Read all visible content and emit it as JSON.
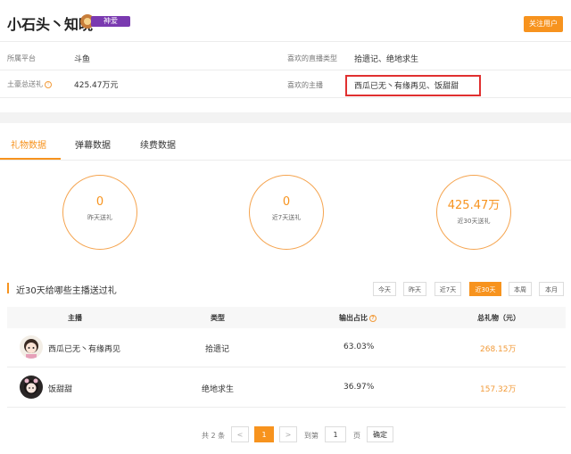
{
  "header": {
    "name": "小石头丶知晓",
    "noble_badge": "神爱",
    "follow_button": "关注用户"
  },
  "info": {
    "platform_label": "所属平台",
    "platform_value": "斗鱼",
    "fav_type_label": "喜欢的直播类型",
    "fav_type_value": "拾遗记、绝地求生",
    "total_gift_label": "土豪总送礼",
    "total_gift_value": "425.47万元",
    "fav_anchor_label": "喜欢的主播",
    "fav_anchor_value": "西瓜已无丶有缘再见、饭甜甜"
  },
  "tabs": [
    "礼物数据",
    "弹幕数据",
    "续费数据"
  ],
  "stats": [
    {
      "value": "0",
      "caption": "昨天送礼"
    },
    {
      "value": "0",
      "caption": "近7天送礼"
    },
    {
      "value": "425.47万",
      "caption": "近30天送礼"
    }
  ],
  "section": {
    "title": "近30天给哪些主播送过礼",
    "filters": [
      "今天",
      "昨天",
      "近7天",
      "近30天",
      "本周",
      "本月"
    ],
    "active_filter": "近30天"
  },
  "table": {
    "headers": [
      "主播",
      "类型",
      "输出占比",
      "总礼物（元）"
    ],
    "rows": [
      {
        "anchor": "西瓜已无丶有缘再见",
        "type": "拾遗记",
        "share": "63.03%",
        "total": "268.15万"
      },
      {
        "anchor": "饭甜甜",
        "type": "绝地求生",
        "share": "36.97%",
        "total": "157.32万"
      }
    ]
  },
  "pagination": {
    "total_text": "共 2 条",
    "prev": "<",
    "current": "1",
    "next": ">",
    "goto_label": "到第",
    "goto_value": "1",
    "page_unit": "页",
    "confirm": "确定"
  },
  "colors": {
    "accent": "#f7931e",
    "highlight_box": "#e03030",
    "noble": "#7a3ab0"
  }
}
